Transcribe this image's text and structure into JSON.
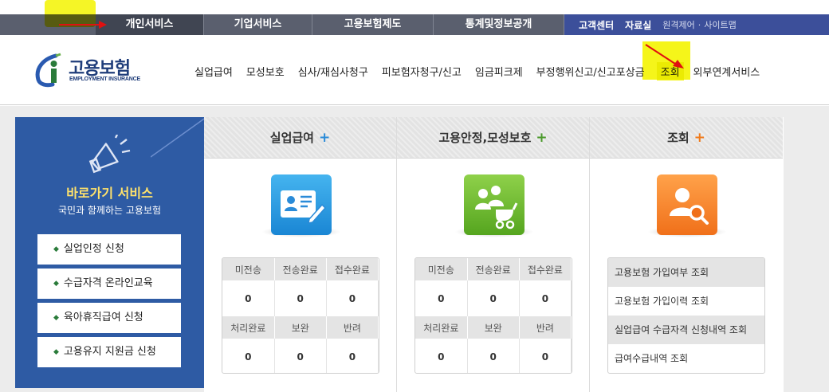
{
  "gnb": {
    "items": [
      {
        "label": "개인서비스"
      },
      {
        "label": "기업서비스"
      },
      {
        "label": "고용보험제도"
      },
      {
        "label": "통계및정보공개"
      }
    ],
    "right": {
      "customer": "고객센터",
      "library": "자료실",
      "remote": "원격제어",
      "sep": "·",
      "sitemap": "사이트맵"
    }
  },
  "logo": {
    "title": "고용보험",
    "sub": "EMPLOYMENT INSURANCE"
  },
  "menu": [
    {
      "label": "실업급여"
    },
    {
      "label": "모성보호"
    },
    {
      "label": "심사/재심사청구"
    },
    {
      "label": "피보험자청구/신고"
    },
    {
      "label": "임금피크제"
    },
    {
      "label": "부정행위신고/신고포상금"
    },
    {
      "label": "조회"
    },
    {
      "label": "외부연계서비스"
    }
  ],
  "quick": {
    "title": "바로가기 서비스",
    "subtitle": "국민과 함께하는 고용보험",
    "buttons": [
      {
        "label": "실업인정 신청"
      },
      {
        "label": "수급자격 온라인교육"
      },
      {
        "label": "육아휴직급여 신청"
      },
      {
        "label": "고용유지 지원금 신청"
      }
    ]
  },
  "columns": [
    {
      "title": "실업급여",
      "plus": "+",
      "plus_color": "#2a8bd8",
      "icon": "id-card-pen-icon",
      "stats": {
        "row1_labels": [
          "미전송",
          "전송완료",
          "접수완료"
        ],
        "row1_values": [
          "0",
          "0",
          "0"
        ],
        "row2_labels": [
          "처리완료",
          "보완",
          "반려"
        ],
        "row2_values": [
          "0",
          "0",
          "0"
        ]
      }
    },
    {
      "title": "고용안정,모성보호",
      "plus": "+",
      "plus_color": "#4a9a2a",
      "icon": "family-stroller-icon",
      "stats": {
        "row1_labels": [
          "미전송",
          "전송완료",
          "접수완료"
        ],
        "row1_values": [
          "0",
          "0",
          "0"
        ],
        "row2_labels": [
          "처리완료",
          "보완",
          "반려"
        ],
        "row2_values": [
          "0",
          "0",
          "0"
        ]
      }
    },
    {
      "title": "조회",
      "plus": "+",
      "plus_color": "#f07a1a",
      "icon": "person-search-icon",
      "links": [
        "고용보험 가입여부 조회",
        "고용보험 가입이력 조회",
        "실업급여 수급자격 신청내역 조회",
        "급여수급내역 조회"
      ]
    }
  ]
}
